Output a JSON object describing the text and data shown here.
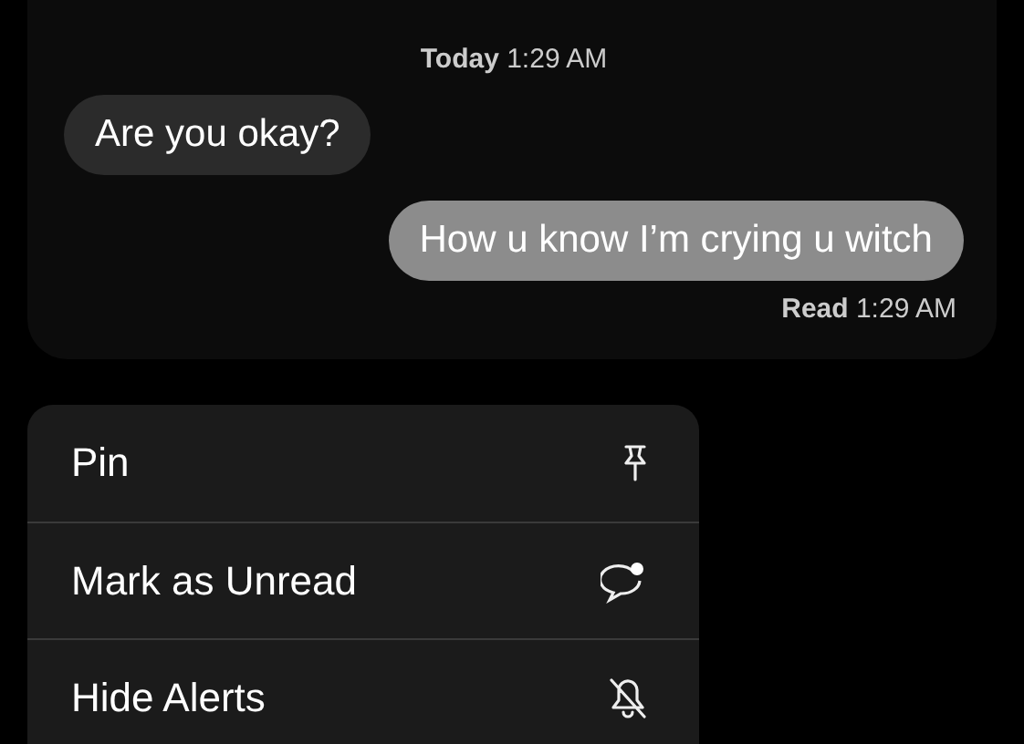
{
  "conversation": {
    "timestamp": {
      "day": "Today",
      "time": "1:29 AM"
    },
    "messages": [
      {
        "kind": "received",
        "text": "Are you okay?"
      },
      {
        "kind": "sent",
        "text": "How u know I’m crying u witch"
      }
    ],
    "receipt": {
      "status": "Read",
      "time": "1:29 AM"
    }
  },
  "menu": [
    {
      "label": "Pin",
      "kind": "pin"
    },
    {
      "label": "Mark as Unread",
      "kind": "unread"
    },
    {
      "label": "Hide Alerts",
      "kind": "mute"
    }
  ]
}
